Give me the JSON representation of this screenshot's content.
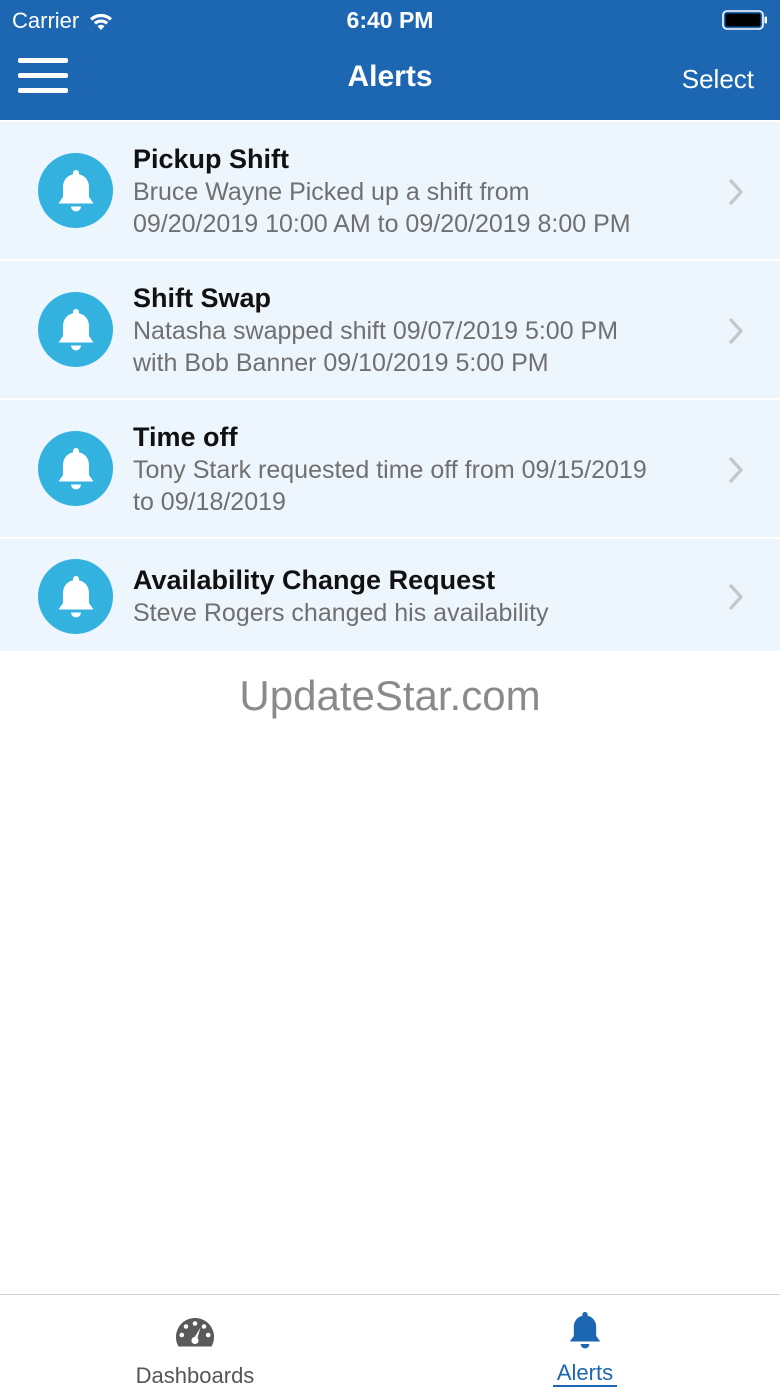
{
  "status_bar": {
    "carrier": "Carrier",
    "time": "6:40 PM"
  },
  "nav": {
    "title": "Alerts",
    "select_label": "Select"
  },
  "alerts": [
    {
      "title": "Pickup Shift",
      "desc_line1": "Bruce Wayne Picked up a shift from",
      "desc_line2": "09/20/2019 10:00 AM to 09/20/2019 8:00 PM"
    },
    {
      "title": "Shift Swap",
      "desc_line1": "Natasha swapped shift 09/07/2019 5:00 PM",
      "desc_line2": "with Bob Banner 09/10/2019 5:00 PM"
    },
    {
      "title": "Time off",
      "desc_line1": "Tony Stark requested time off from 09/15/2019",
      "desc_line2": "to 09/18/2019"
    },
    {
      "title": "Availability Change Request",
      "desc_line1": "Steve Rogers changed his availability",
      "desc_line2": ""
    }
  ],
  "watermark": "UpdateStar.com",
  "tabs": [
    {
      "label": "Dashboards",
      "icon": "dashboard-gauge-icon",
      "active": false
    },
    {
      "label": "Alerts",
      "icon": "bell-icon",
      "active": true
    }
  ],
  "colors": {
    "header": "#1c66b2",
    "row_bg": "#eef6fd",
    "bell_circle": "#33b2e0",
    "active_tab": "#1c66b2"
  }
}
